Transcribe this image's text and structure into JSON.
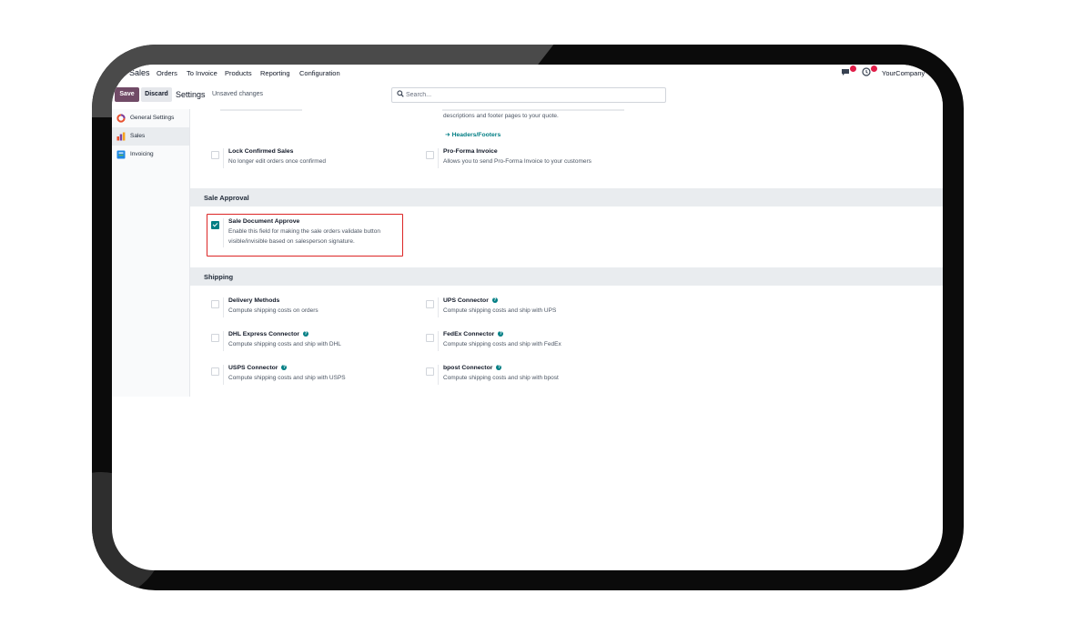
{
  "navbar": {
    "app": "Sales",
    "menu": [
      "Orders",
      "To Invoice",
      "Products",
      "Reporting",
      "Configuration"
    ],
    "messages_badge": "",
    "activity_badge": "",
    "company": "YourCompany"
  },
  "control_panel": {
    "save_label": "Save",
    "discard_label": "Discard",
    "title": "Settings",
    "status": "Unsaved changes",
    "search_placeholder": "Search..."
  },
  "sidebar": {
    "items": [
      {
        "label": "General Settings",
        "icon": "odoo-logo-icon"
      },
      {
        "label": "Sales",
        "icon": "sales-chart-icon",
        "active": true
      },
      {
        "label": "Invoicing",
        "icon": "invoicing-icon"
      }
    ]
  },
  "top_section": {
    "right_partial_desc": "descriptions and footer pages to your quote.",
    "headers_footers_link": "➜ Headers/Footers",
    "lock": {
      "title": "Lock Confirmed Sales",
      "desc": "No longer edit orders once confirmed",
      "checked": false
    },
    "proforma": {
      "title": "Pro-Forma Invoice",
      "desc": "Allows you to send Pro-Forma Invoice to your customers",
      "checked": false
    }
  },
  "sale_approval": {
    "heading": "Sale Approval",
    "setting": {
      "title": "Sale Document Approve",
      "desc": "Enable this field for making the sale orders validate button visible/invisible based on salesperson signature.",
      "checked": true
    }
  },
  "shipping": {
    "heading": "Shipping",
    "settings": [
      {
        "title": "Delivery Methods",
        "desc": "Compute shipping costs on orders",
        "help": false
      },
      {
        "title": "UPS Connector",
        "desc": "Compute shipping costs and ship with UPS",
        "help": true
      },
      {
        "title": "DHL Express Connector",
        "desc": "Compute shipping costs and ship with DHL",
        "help": true
      },
      {
        "title": "FedEx Connector",
        "desc": "Compute shipping costs and ship with FedEx",
        "help": true
      },
      {
        "title": "USPS Connector",
        "desc": "Compute shipping costs and ship with USPS",
        "help": true
      },
      {
        "title": "bpost Connector",
        "desc": "Compute shipping costs and ship with bpost",
        "help": true
      }
    ]
  },
  "colors": {
    "primary": "#714b67",
    "link": "#017e84",
    "highlight_border": "#dc2626",
    "badge": "#e11d48"
  }
}
